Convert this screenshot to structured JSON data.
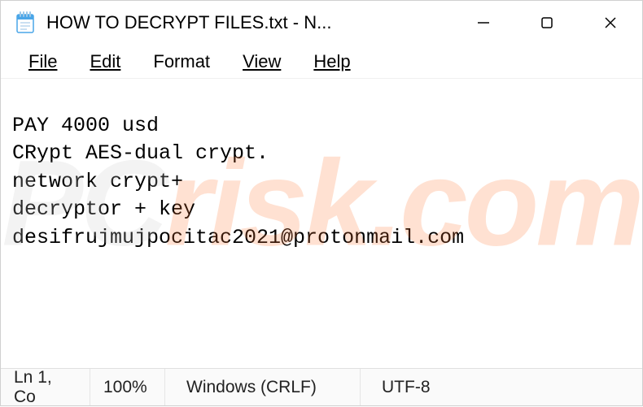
{
  "window": {
    "title": "HOW TO DECRYPT FILES.txt - N..."
  },
  "menubar": {
    "file": "File",
    "edit": "Edit",
    "format": "Format",
    "view": "View",
    "help": "Help"
  },
  "content": {
    "text": "\nPAY 4000 usd\nCRypt AES-dual crypt.\nnetwork crypt+\ndecryptor + key\ndesifrujmujpocitac2021@protonmail.com"
  },
  "statusbar": {
    "position": "Ln 1, Co",
    "zoom": "100%",
    "line_ending": "Windows (CRLF)",
    "encoding": "UTF-8"
  },
  "watermark": {
    "left": "PC",
    "right": "risk.com"
  }
}
